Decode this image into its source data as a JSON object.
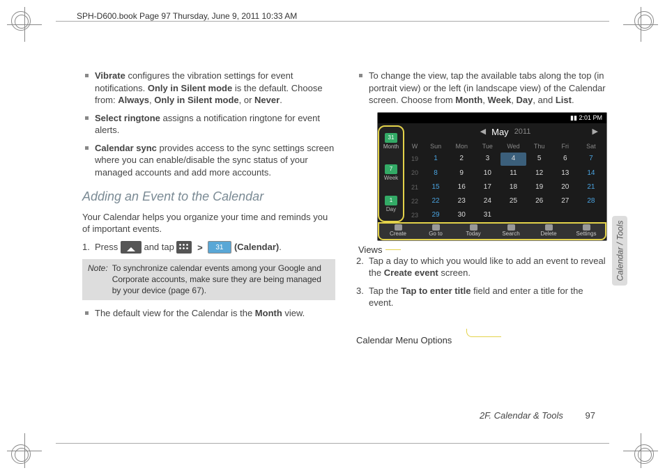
{
  "domain": "Document",
  "doc_header": "SPH-D600.book  Page 97  Thursday, June 9, 2011  10:33 AM",
  "left": {
    "vibrate_label": "Vibrate",
    "vibrate_text": " configures the vibration settings for event notifications. ",
    "vibrate_default_bold": "Only in Silent mode",
    "vibrate_text2": " is the default. Choose from: ",
    "vibrate_opt1": "Always",
    "vibrate_comma": ", ",
    "vibrate_opt2": "Only in Silent mode",
    "vibrate_or": ", or ",
    "vibrate_opt3": "Never",
    "vibrate_period": ".",
    "ringtone_label": "Select ringtone",
    "ringtone_text": " assigns a notification ringtone for event alerts.",
    "sync_label": "Calendar sync",
    "sync_text": " provides access to the sync settings screen where you can enable/disable the sync status of your managed accounts and add more accounts.",
    "section_heading": "Adding an Event to the Calendar",
    "intro": "Your Calendar helps you organize your time and reminds you of important events.",
    "step1_num": "1.",
    "step1_a": "Press ",
    "step1_b": " and tap ",
    "step1_gt": ">",
    "step1_cal": " (Calendar)",
    "step1_period": ".",
    "note_label": "Note:",
    "note_text": "To synchronize calendar events among your Google and Corporate accounts, make sure they are being managed by your device (page 67).",
    "default_view_a": "The default view for the Calendar is the ",
    "default_view_bold": "Month",
    "default_view_b": " view."
  },
  "right": {
    "changeview_a": "To change the view, tap the available tabs along the top (in portrait view) or the left (in landscape view) of the Calendar screen. Choose from ",
    "cv_month": "Month",
    "cv_c1": ", ",
    "cv_week": "Week",
    "cv_c2": ", ",
    "cv_day": "Day",
    "cv_c3": ", and ",
    "cv_list": "List",
    "cv_period": ".",
    "callout_views": "Views",
    "callout_menu": "Calendar Menu Options",
    "step2_num": "2.",
    "step2_a": "Tap a day to which you would like to add an event to reveal the ",
    "step2_bold": "Create event",
    "step2_b": " screen.",
    "step3_num": "3.",
    "step3_a": "Tap the ",
    "step3_bold": "Tap to enter title",
    "step3_b": " field and enter a title for the event."
  },
  "calendar": {
    "status_time": "2:01 PM",
    "month": "May",
    "year": "2011",
    "view_items": [
      {
        "icon": "31",
        "label": "Month"
      },
      {
        "icon": "7",
        "label": "Week"
      },
      {
        "icon": "1",
        "label": "Day"
      }
    ],
    "day_headers": [
      "W",
      "Sun",
      "Mon",
      "Tue",
      "Wed",
      "Thu",
      "Fri",
      "Sat"
    ],
    "weeks": [
      {
        "wk": "19",
        "days": [
          "1",
          "2",
          "3",
          "4",
          "5",
          "6",
          "7"
        ],
        "blue": [
          0,
          6
        ],
        "today": 3
      },
      {
        "wk": "20",
        "days": [
          "8",
          "9",
          "10",
          "11",
          "12",
          "13",
          "14"
        ],
        "blue": [
          0,
          6
        ]
      },
      {
        "wk": "21",
        "days": [
          "15",
          "16",
          "17",
          "18",
          "19",
          "20",
          "21"
        ],
        "blue": [
          0,
          6
        ]
      },
      {
        "wk": "22",
        "days": [
          "22",
          "23",
          "24",
          "25",
          "26",
          "27",
          "28"
        ],
        "blue": [
          0,
          6
        ]
      },
      {
        "wk": "23",
        "days": [
          "29",
          "30",
          "31",
          "",
          "",
          "",
          ""
        ],
        "blue": [
          0
        ]
      }
    ],
    "menu_items": [
      "Create",
      "Go to",
      "Today",
      "Search",
      "Delete",
      "Settings"
    ]
  },
  "sidetab": "Calendar / Tools",
  "footer": {
    "section": "2F. Calendar & Tools",
    "page": "97"
  },
  "chart_data": {
    "type": "table",
    "title": "May 2011 month-view calendar grid",
    "columns": [
      "Week#",
      "Sun",
      "Mon",
      "Tue",
      "Wed",
      "Thu",
      "Fri",
      "Sat"
    ],
    "rows": [
      [
        "19",
        "1",
        "2",
        "3",
        "4",
        "5",
        "6",
        "7"
      ],
      [
        "20",
        "8",
        "9",
        "10",
        "11",
        "12",
        "13",
        "14"
      ],
      [
        "21",
        "15",
        "16",
        "17",
        "18",
        "19",
        "20",
        "21"
      ],
      [
        "22",
        "22",
        "23",
        "24",
        "25",
        "26",
        "27",
        "28"
      ],
      [
        "23",
        "29",
        "30",
        "31",
        "",
        "",
        "",
        ""
      ]
    ],
    "highlighted_cell": {
      "row": 0,
      "col": "Wed",
      "value": "4",
      "meaning": "current day"
    },
    "weekend_columns": [
      "Sun",
      "Sat"
    ]
  }
}
